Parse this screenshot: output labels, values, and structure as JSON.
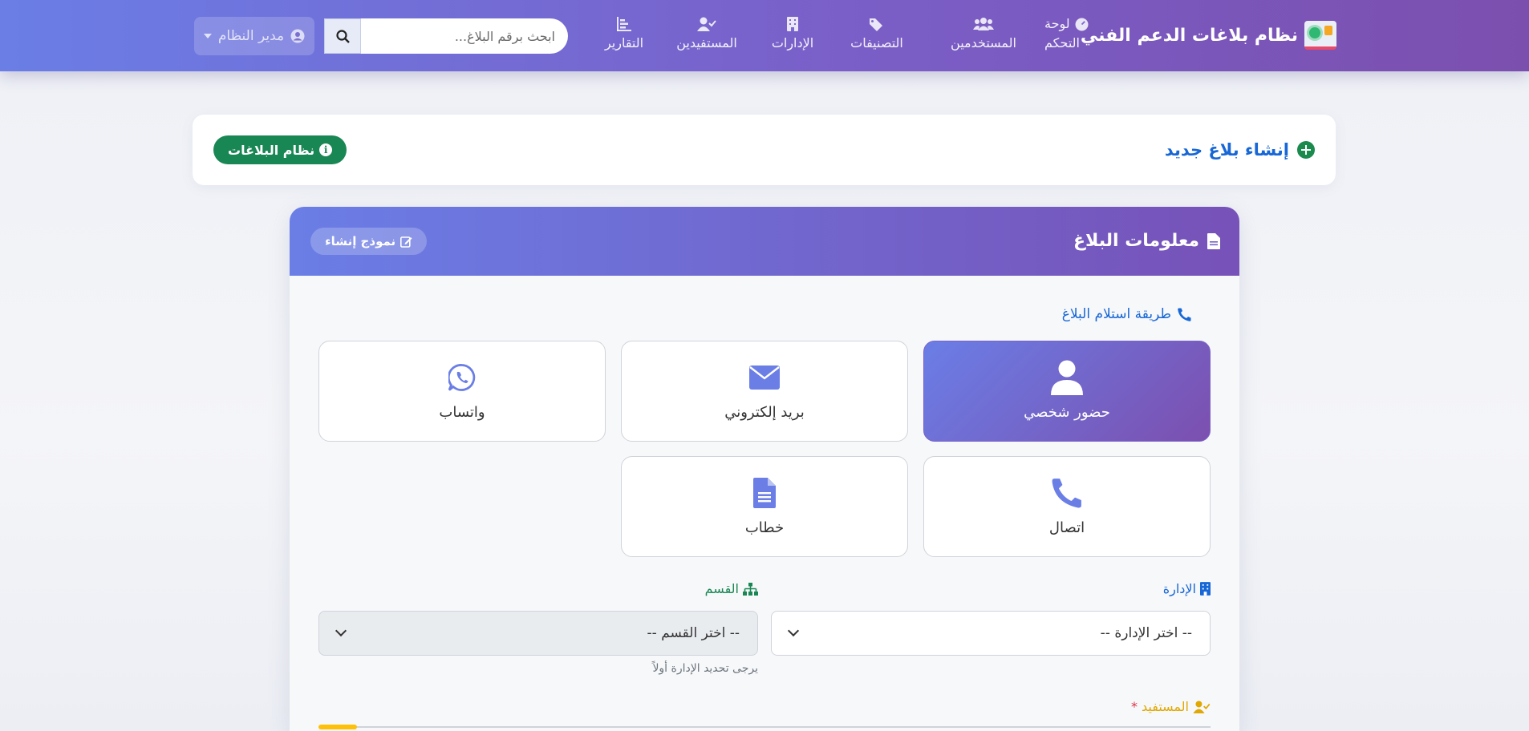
{
  "navbar": {
    "brand": "نظام بلاغات الدعم الفني",
    "items": [
      {
        "line1": "لوحة",
        "line2": "التحكم",
        "icon": "gauge-icon"
      },
      {
        "label": "المستخدمين",
        "icon": "users-icon"
      },
      {
        "label": "التصنيفات",
        "icon": "tags-icon"
      },
      {
        "label": "الإدارات",
        "icon": "building-icon"
      },
      {
        "label": "المستفيدين",
        "icon": "user-check-icon"
      },
      {
        "label": "التقارير",
        "icon": "chart-bars-icon"
      }
    ],
    "search_placeholder": "ابحث برقم البلاغ...",
    "user_label": "مدير النظام"
  },
  "page_header": {
    "title": "إنشاء بلاغ جديد",
    "badge": "نظام البلاغات"
  },
  "card": {
    "title": "معلومات البلاغ",
    "form_button": "نموذج إنشاء",
    "method_label": "طريقة استلام البلاغ",
    "methods": [
      {
        "label": "حضور شخصي",
        "icon": "user-icon",
        "active": true
      },
      {
        "label": "بريد إلكتروني",
        "icon": "envelope-icon",
        "active": false
      },
      {
        "label": "واتساب",
        "icon": "whatsapp-icon",
        "active": false
      },
      {
        "label": "اتصال",
        "icon": "phone-icon",
        "active": false
      },
      {
        "label": "خطاب",
        "icon": "document-icon",
        "active": false
      }
    ],
    "department_label": "الإدارة",
    "department_placeholder": "-- اختر الإدارة --",
    "section_label": "القسم",
    "section_placeholder": "-- اختر القسم --",
    "section_hint": "يرجى تحديد الإدارة أولاً",
    "beneficiary_label": "المستفيد",
    "required_mark": "*"
  },
  "colors": {
    "accent": "#6a7ee6",
    "accent_dark": "#7b4fae",
    "link_blue": "#1767d6",
    "success": "#198754",
    "warning": "#ffc107",
    "danger": "#dc3545"
  }
}
